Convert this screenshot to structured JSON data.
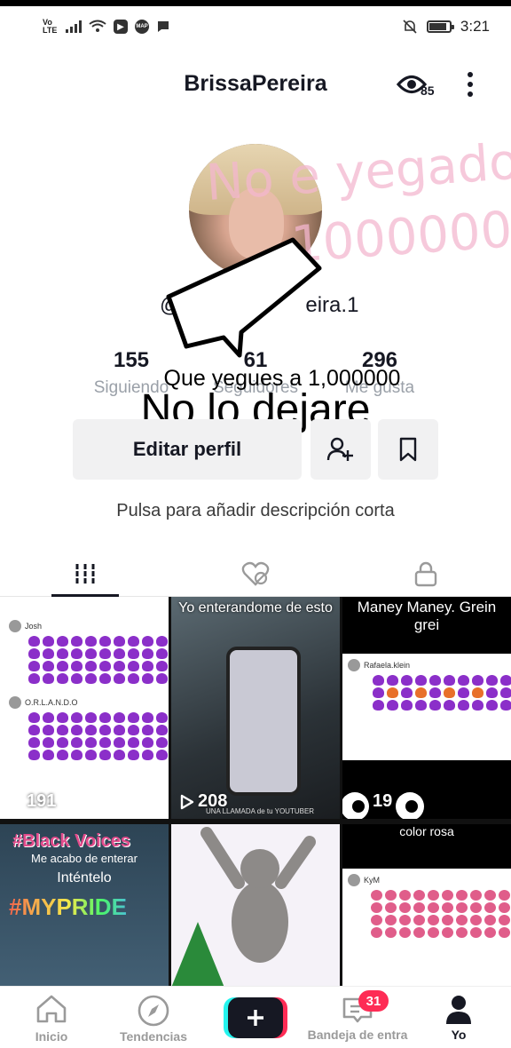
{
  "status_bar": {
    "network": "Vo LTE",
    "app_badge_1": "▶",
    "app_badge_2": "MAP",
    "time": "3:21"
  },
  "header": {
    "username": "BrissaPereira",
    "viewers_count": "85"
  },
  "profile": {
    "handle_start": "@",
    "handle_end": "eira.1",
    "overlay_line1": "No e yegado a",
    "overlay_line2": "1000000",
    "caption_line1": "Que yegues a 1,000000",
    "caption_line2": "No lo dejare",
    "stats": [
      {
        "value": "155",
        "label": "Siguiendo"
      },
      {
        "value": "61",
        "label": "Seguidores"
      },
      {
        "value": "296",
        "label": "Me gusta"
      }
    ],
    "edit_profile_label": "Editar perfil",
    "bio_prompt": "Pulsa para añadir descripción corta"
  },
  "tabs": [
    {
      "icon": "grid-icon",
      "active": true
    },
    {
      "icon": "liked-hidden-icon",
      "active": false
    },
    {
      "icon": "lock-icon",
      "active": false
    }
  ],
  "videos": [
    {
      "views": "191",
      "users": [
        "Josh",
        "O.R.L.A.N.D.O"
      ]
    },
    {
      "views": "208",
      "text": "Yo enterandome de esto",
      "footer": "UNA LLAMADA de tu YOUTUBER"
    },
    {
      "views": "19",
      "text": "Maney Maney. Grein grei",
      "user": "Rafaela.klein"
    },
    {
      "text1": "#Black Voices",
      "text2": "Me acabo de enterar",
      "text3": "Inténtelo",
      "text4": "#MYPRIDE"
    },
    {
      "text": ""
    },
    {
      "text": "color rosa",
      "user": "KyM"
    }
  ],
  "bottom_nav": {
    "home": "Inicio",
    "discover": "Tendencias",
    "inbox": "Bandeja de entra",
    "inbox_badge": "31",
    "profile": "Yo"
  }
}
